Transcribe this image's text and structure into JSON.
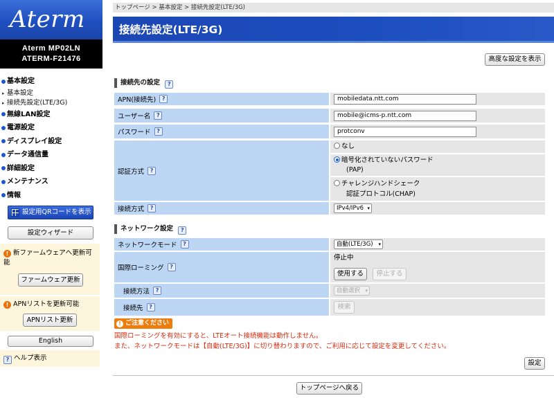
{
  "brand": {
    "logo_text": "Aterm",
    "model_line1": "Aterm  MP02LN",
    "model_line2": "ATERM-F21476"
  },
  "nav": {
    "basic": {
      "label": "基本設定",
      "sub": [
        "基本設定",
        "接続先設定(LTE/3G)"
      ]
    },
    "wireless": "無線LAN設定",
    "power": "電源設定",
    "display": "ディスプレイ設定",
    "data_usage": "データ通信量",
    "advanced": "詳細設定",
    "maintenance": "メンテナンス",
    "info": "情報"
  },
  "sidebar": {
    "qr_button": "設定用QRコードを表示",
    "wizard_button": "設定ウィザード",
    "firmware_notice_line1": "新ファームウェアへ更新可",
    "firmware_notice_line2": "能",
    "firmware_button": "ファームウェア更新",
    "apn_notice": "APNリストを更新可能",
    "apn_button": "APNリスト更新",
    "language_button": "English",
    "help_label": "ヘルプ表示"
  },
  "breadcrumb": "トップページ > 基本設定 > 接続先設定(LTE/3G)",
  "page_title": "接続先設定(LTE/3G)",
  "advanced_button": "高度な設定を表示",
  "connection": {
    "section_title": "接続先の設定",
    "apn_label": "APN(接続先)",
    "apn_value": "mobiledata.ntt.com",
    "user_label": "ユーザー名",
    "user_value": "mobile@icms-p.ntt.com",
    "password_label": "パスワード",
    "password_value": "protconv",
    "auth_label": "認証方式",
    "auth_options": {
      "none": "なし",
      "pap_line1": "暗号化されていないパスワード",
      "pap_line2": "(PAP)",
      "chap_line1": "チャレンジハンドシェーク",
      "chap_line2": "認証プロトコル(CHAP)"
    },
    "auth_selected": "pap",
    "ip_label": "接続方式",
    "ip_value": "IPv4/IPv6"
  },
  "network": {
    "section_title": "ネットワーク設定",
    "mode_label": "ネットワークモード",
    "mode_value": "自動(LTE/3G)",
    "roaming_label": "国際ローミング",
    "roaming_status": "停止中",
    "roaming_use_button": "使用する",
    "roaming_stop_button": "停止する",
    "method_label": "接続方法",
    "method_value": "自動選択",
    "carrier_label": "接続先",
    "search_button": "検索"
  },
  "caution": {
    "badge": "ご注意ください",
    "line1": "国際ローミングを有効にすると、LTEオート接続機能は動作しません。",
    "line2": "また、ネットワークモードは【自動(LTE/3G)】に切り替わりますので、ご利用に応じて設定を変更してください。"
  },
  "set_button": "設定",
  "top_button": "トップページへ戻る",
  "help_glyph": "?",
  "warn_glyph": "!",
  "colors": {
    "accent_blue": "#1d4ebf",
    "label_bg": "#bcd6f4",
    "value_bg": "#e6e6e6",
    "warning": "#ee7d10",
    "caution_text": "#d8290d"
  }
}
